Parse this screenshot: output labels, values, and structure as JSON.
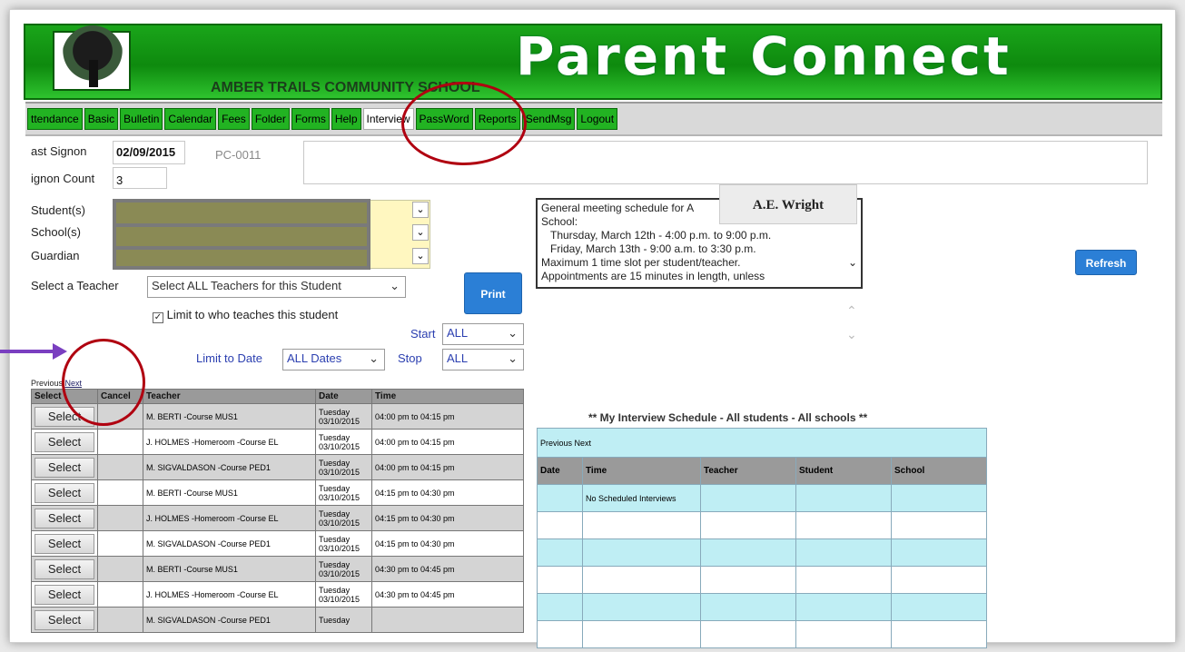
{
  "header": {
    "title": "Parent Connect",
    "school_name": "AMBER TRAILS COMMUNITY SCHOOL"
  },
  "tabs": [
    "ttendance",
    "Basic",
    "Bulletin",
    "Calendar",
    "Fees",
    "Folder",
    "Forms",
    "Help",
    "Interview",
    "PassWord",
    "Reports",
    "SendMsg",
    "Logout"
  ],
  "active_tab": "Interview",
  "signon": {
    "last_label": "ast Signon",
    "last_value": "02/09/2015",
    "pc": "PC-0011",
    "count_label": "ignon Count",
    "count_value": "3"
  },
  "form": {
    "students_label": "Student(s)",
    "schools_label": "School(s)",
    "guardian_label": "Guardian",
    "select_teacher_label": "Select a Teacher",
    "select_teacher_value": "Select ALL Teachers for this Student",
    "limit_checkbox_label": "Limit to who teaches this student",
    "print_label": "Print",
    "start_label": "Start",
    "start_value": "ALL",
    "stop_label": "Stop",
    "stop_value": "ALL",
    "limit_date_label": "Limit to Date",
    "limit_date_value": "ALL Dates",
    "refresh_label": "Refresh"
  },
  "meeting": {
    "lines": [
      "General meeting schedule for A",
      "School:",
      "  Thursday, March 12th - 4:00 p.m. to 9:00 p.m.",
      "  Friday, March 13th - 9:00 a.m. to 3:30 p.m.",
      "Maximum 1 time slot per student/teacher.",
      "Appointments are 15 minutes in length, unless"
    ],
    "overlay": "A.E. Wright"
  },
  "grid": {
    "pager_prev": "Previous",
    "pager_next": "Next",
    "headers": [
      "Select",
      "Cancel",
      "Teacher",
      "Date",
      "Time"
    ],
    "select_label": "Select",
    "rows": [
      {
        "teacher": "M. BERTI -Course MUS1",
        "day": "Tuesday",
        "date": "03/10/2015",
        "time": "04:00 pm to 04:15 pm"
      },
      {
        "teacher": "J. HOLMES -Homeroom -Course EL",
        "day": "Tuesday",
        "date": "03/10/2015",
        "time": "04:00 pm to 04:15 pm"
      },
      {
        "teacher": "M. SIGVALDASON -Course PED1",
        "day": "Tuesday",
        "date": "03/10/2015",
        "time": "04:00 pm to 04:15 pm"
      },
      {
        "teacher": "M. BERTI -Course MUS1",
        "day": "Tuesday",
        "date": "03/10/2015",
        "time": "04:15 pm to 04:30 pm"
      },
      {
        "teacher": "J. HOLMES -Homeroom -Course EL",
        "day": "Tuesday",
        "date": "03/10/2015",
        "time": "04:15 pm to 04:30 pm"
      },
      {
        "teacher": "M. SIGVALDASON -Course PED1",
        "day": "Tuesday",
        "date": "03/10/2015",
        "time": "04:15 pm to 04:30 pm"
      },
      {
        "teacher": "M. BERTI -Course MUS1",
        "day": "Tuesday",
        "date": "03/10/2015",
        "time": "04:30 pm to 04:45 pm"
      },
      {
        "teacher": "J. HOLMES -Homeroom -Course EL",
        "day": "Tuesday",
        "date": "03/10/2015",
        "time": "04:30 pm to 04:45 pm"
      },
      {
        "teacher": "M. SIGVALDASON -Course PED1",
        "day": "Tuesday",
        "date": "",
        "time": ""
      }
    ]
  },
  "schedule": {
    "title": "** My Interview Schedule - All students - All schools **",
    "pager": "Previous Next",
    "headers": [
      "Date",
      "Time",
      "Teacher",
      "Student",
      "School"
    ],
    "empty_text": "No Scheduled Interviews"
  },
  "colors": {
    "banner_green": "#15a015",
    "tab_green": "#22b322",
    "annotation_red": "#b00010",
    "arrow_purple": "#7a3fc0",
    "schedule_cyan": "#bfeef4"
  }
}
